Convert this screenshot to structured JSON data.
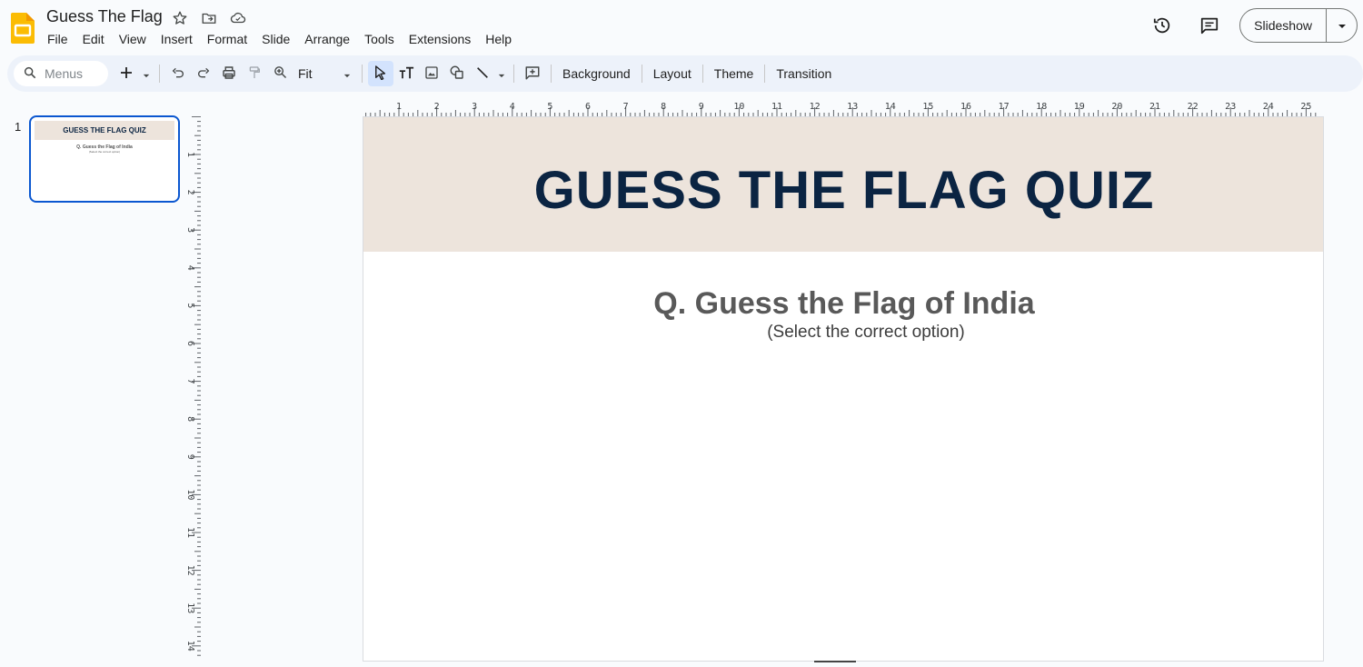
{
  "document": {
    "title": "Guess The Flag"
  },
  "menu": [
    "File",
    "Edit",
    "View",
    "Insert",
    "Format",
    "Slide",
    "Arrange",
    "Tools",
    "Extensions",
    "Help"
  ],
  "header_right": {
    "slideshow_label": "Slideshow"
  },
  "toolbar": {
    "search_placeholder": "Menus",
    "zoom_value": "Fit",
    "background_label": "Background",
    "layout_label": "Layout",
    "theme_label": "Theme",
    "transition_label": "Transition"
  },
  "filmstrip": {
    "slides": [
      {
        "number": "1",
        "title": "GUESS THE FLAG QUIZ",
        "question": "Q. Guess the Flag of India",
        "subtitle": "(Select the correct option)"
      }
    ]
  },
  "ruler": {
    "horizontal_labels": [
      "1",
      "2",
      "3",
      "4",
      "5",
      "6",
      "7",
      "8",
      "9",
      "10",
      "11",
      "12",
      "13",
      "14",
      "15",
      "16",
      "17",
      "18",
      "19",
      "20",
      "21",
      "22",
      "23",
      "24",
      "25"
    ],
    "vertical_labels": [
      "1",
      "2",
      "3",
      "4",
      "5",
      "6",
      "7",
      "8",
      "9",
      "10",
      "11",
      "12",
      "13",
      "14"
    ]
  },
  "slide": {
    "title": "GUESS THE FLAG QUIZ",
    "question": "Q. Guess the Flag of India",
    "subtitle": "(Select the correct option)",
    "header_color": "#ede4dc",
    "title_color": "#0b2442"
  },
  "colors": {
    "accent": "#0b57d0",
    "toolbar_bg": "#edf2fa",
    "app_yellow": "#fbbc04"
  }
}
